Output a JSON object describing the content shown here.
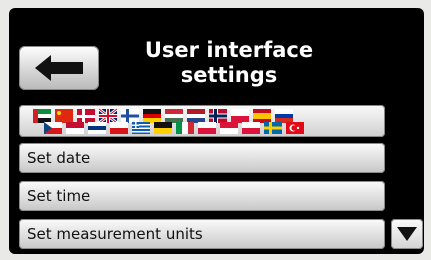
{
  "header": {
    "title_line1": "User interface",
    "title_line2": "settings",
    "back_icon": "arrow-left-icon"
  },
  "languages": [
    "ar",
    "cn",
    "dk",
    "gb",
    "fi",
    "de",
    "hu",
    "nl",
    "no",
    "pl",
    "es",
    "tr",
    "cz",
    "gr",
    "it",
    "ru",
    "se"
  ],
  "menu": {
    "items": [
      {
        "label": "Set date"
      },
      {
        "label": "Set time"
      },
      {
        "label": "Set measurement units"
      }
    ]
  },
  "scroll": {
    "icon": "triangle-down-icon"
  }
}
